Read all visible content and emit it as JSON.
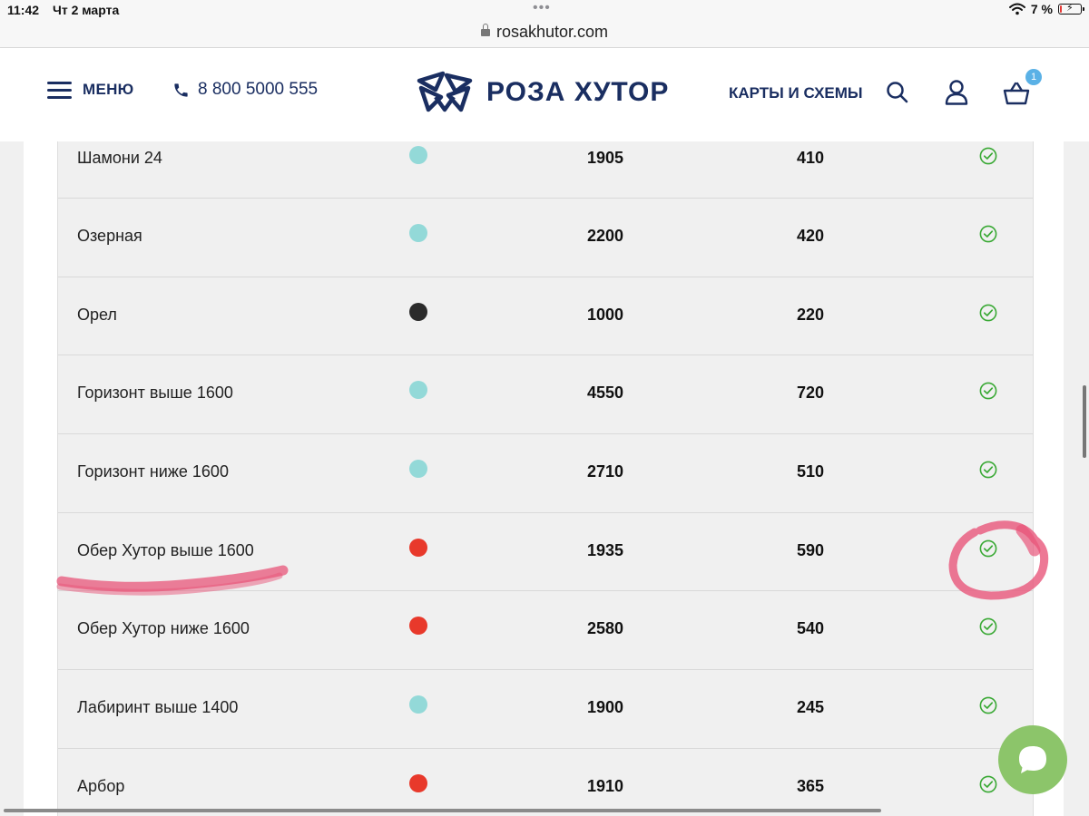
{
  "status_bar": {
    "time": "11:42",
    "date": "Чт 2 марта",
    "battery_text": "7 %",
    "icons": [
      "wifi-icon",
      "battery-charging-icon"
    ]
  },
  "browser": {
    "url": "rosakhutor.com"
  },
  "header": {
    "menu_label": "МЕНЮ",
    "phone": "8 800 5000 555",
    "logo_text": "РОЗА ХУТОР",
    "maps_link": "КАРТЫ И СХЕМЫ",
    "cart_count": "1",
    "icons": [
      "hamburger-icon",
      "phone-icon",
      "logo-icon",
      "search-icon",
      "user-icon",
      "cart-icon"
    ]
  },
  "colors": {
    "brand": "#1a2e61",
    "difficulty_blue": "#93d9d8",
    "difficulty_black": "#2b2b2b",
    "difficulty_red": "#e8392b",
    "status_open": "#3aa935",
    "annotation": "#e8567a",
    "chat": "#8cc56a"
  },
  "trails": [
    {
      "name": "Шамони 24",
      "difficulty_color": "#93d9d8",
      "length": "1905",
      "drop": "410",
      "status": "open"
    },
    {
      "name": "Озерная",
      "difficulty_color": "#93d9d8",
      "length": "2200",
      "drop": "420",
      "status": "open"
    },
    {
      "name": "Орел",
      "difficulty_color": "#2b2b2b",
      "length": "1000",
      "drop": "220",
      "status": "open"
    },
    {
      "name": "Горизонт выше 1600",
      "difficulty_color": "#93d9d8",
      "length": "4550",
      "drop": "720",
      "status": "open"
    },
    {
      "name": "Горизонт ниже 1600",
      "difficulty_color": "#93d9d8",
      "length": "2710",
      "drop": "510",
      "status": "open"
    },
    {
      "name": "Обер Хутор выше 1600",
      "difficulty_color": "#e8392b",
      "length": "1935",
      "drop": "590",
      "status": "open"
    },
    {
      "name": "Обер Хутор ниже 1600",
      "difficulty_color": "#e8392b",
      "length": "2580",
      "drop": "540",
      "status": "open"
    },
    {
      "name": "Лабиринт выше 1400",
      "difficulty_color": "#93d9d8",
      "length": "1900",
      "drop": "245",
      "status": "open"
    },
    {
      "name": "Арбор",
      "difficulty_color": "#e8392b",
      "length": "1910",
      "drop": "365",
      "status": "open"
    }
  ]
}
